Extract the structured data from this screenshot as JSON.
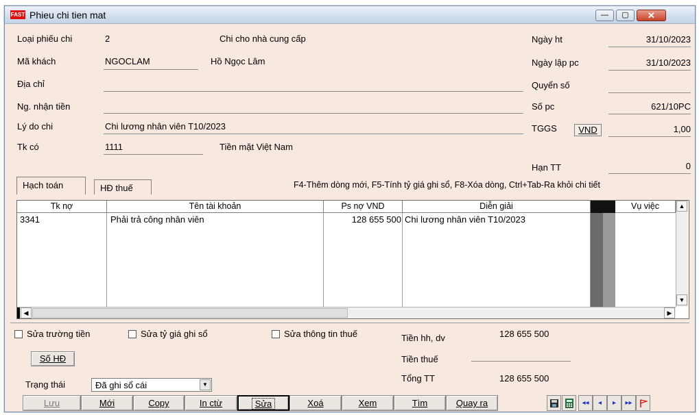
{
  "window": {
    "title": "Phieu chi tien mat",
    "logo_text": "FAST",
    "min_glyph": "—",
    "max_glyph": "▢",
    "close_glyph": "✕"
  },
  "header": {
    "loai_phieu_label": "Loại phiếu chi",
    "loai_phieu_value": "2",
    "loai_phieu_desc": "Chi cho nhà cung cấp",
    "ma_khach_label": "Mã khách",
    "ma_khach_value": "NGOCLAM",
    "ma_khach_name": "Hồ Ngọc Lâm",
    "dia_chi_label": "Địa chỉ",
    "ng_nhan_label": "Ng. nhận tiền",
    "ly_do_label": "Lý do chi",
    "ly_do_value": "Chi lương nhân viên T10/2023",
    "tk_co_label": "Tk có",
    "tk_co_value": "1111",
    "tk_co_name": "Tiền mặt Việt Nam",
    "ngay_ht_label": "Ngày ht",
    "ngay_ht_value": "31/10/2023",
    "ngay_lap_label": "Ngày lập pc",
    "ngay_lap_value": "31/10/2023",
    "quyen_so_label": "Quyển số",
    "so_pc_label": "Số pc",
    "so_pc_value": "621/10PC",
    "tggs_label": "TGGS",
    "currency": "VND",
    "tggs_value": "1,00",
    "han_tt_label": "Hạn TT",
    "han_tt_value": "0"
  },
  "tabs": {
    "hach_toan": "Hạch toán",
    "hd_thue": "HĐ thuế"
  },
  "hint": "F4-Thêm dòng mới, F5-Tính tỷ giá ghi sổ, F8-Xóa dòng, Ctrl+Tab-Ra khỏi chi tiết",
  "grid": {
    "columns": {
      "tk_no": "Tk nợ",
      "ten_tk": "Tên tài khoản",
      "ps_no": "Ps nợ VND",
      "dien_giai": "Diễn giải",
      "vu_viec": "Vụ việc"
    },
    "rows": [
      {
        "tk_no": "3341",
        "ten_tk": "Phải trả công nhân viên",
        "ps_no": "128 655 500",
        "dien_giai": "Chi lương nhân viên T10/2023"
      }
    ]
  },
  "footer": {
    "sua_truong_tien": "Sửa trường tiền",
    "sua_ty_gia": "Sửa tỷ giá ghi sổ",
    "sua_thong_tin_thue": "Sửa thông tin thuế",
    "so_hd_button": "Số HĐ",
    "tien_hh_label": "Tiền hh, dv",
    "tien_hh_value": "128 655 500",
    "tien_thue_label": "Tiền thuế",
    "tong_tt_label": "Tổng TT",
    "tong_tt_value": "128 655 500",
    "trang_thai_label": "Trạng thái",
    "trang_thai_value": "Đã ghi sổ cái"
  },
  "toolbar": {
    "luu": "Lưu",
    "moi": "Mới",
    "copy": "Copy",
    "in_ctu": "In ctừ",
    "sua": "Sửa",
    "xoa": "Xoá",
    "xem": "Xem",
    "tim": "Tìm",
    "quay_ra": "Quay ra"
  },
  "nav": {
    "first": "◂◂",
    "prev": "◂",
    "next": "▸",
    "last": "▸▸"
  },
  "colors": {
    "form_bg": "#f7e9df",
    "nav_blue": "#2030c0",
    "flag_red": "#d11"
  }
}
